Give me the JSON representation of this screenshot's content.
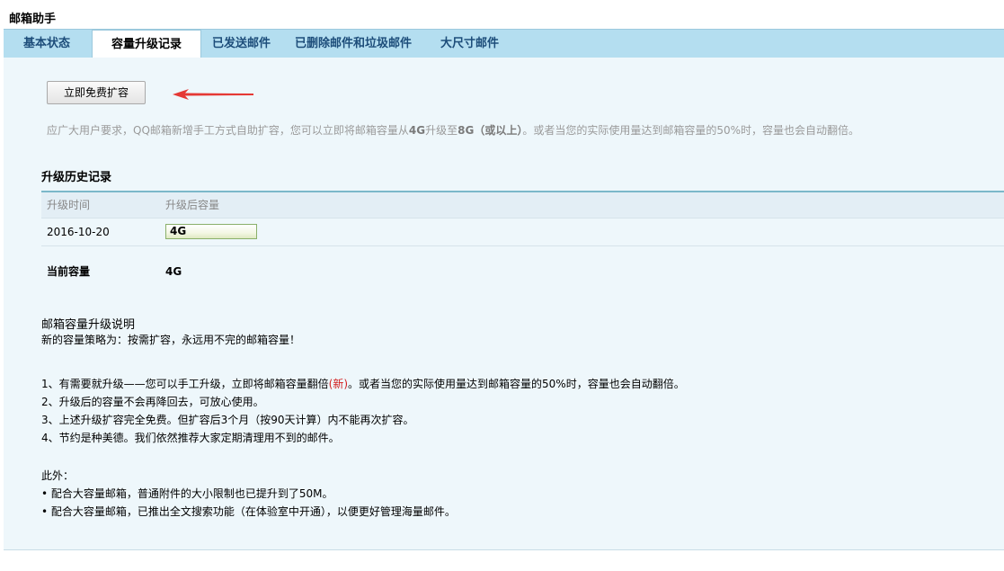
{
  "app": {
    "title": "邮箱助手"
  },
  "tabs": [
    {
      "label": "基本状态"
    },
    {
      "label": "容量升级记录"
    },
    {
      "label": "已发送邮件"
    },
    {
      "label": "已删除邮件和垃圾邮件"
    },
    {
      "label": "大尺寸邮件"
    }
  ],
  "active_tab": "容量升级记录",
  "expand_button": {
    "label": "立即免费扩容"
  },
  "intro": {
    "part1": "应广大用户要求，QQ邮箱新增手工方式自助扩容，您可以立即将邮箱容量从",
    "from": "4G",
    "part2": "升级至",
    "to": "8G（或以上）",
    "part3": "。或者当您的实际使用量达到邮箱容量的50%时，容量也会自动翻倍。"
  },
  "history": {
    "title": "升级历史记录",
    "col_time": "升级时间",
    "col_capacity": "升级后容量",
    "rows": [
      {
        "time": "2016-10-20",
        "capacity": "4G"
      }
    ],
    "current_label": "当前容量",
    "current_value": "4G"
  },
  "explain": {
    "title": "邮箱容量升级说明",
    "subtitle": "新的容量策略为：按需扩容，永远用不完的邮箱容量！",
    "item1_a": "1、有需要就升级——您可以手工升级，立即将邮箱容量翻倍",
    "item1_new": "(新)",
    "item1_b": "。或者当您的实际使用量达到邮箱容量的50%时，容量也会自动翻倍。",
    "item2": "2、升级后的容量不会再降回去，可放心使用。",
    "item3": "3、上述升级扩容完全免费。但扩容后3个月（按90天计算）内不能再次扩容。",
    "item4": "4、节约是种美德。我们依然推荐大家定期清理用不到的邮件。",
    "extra_title": "此外：",
    "extra1": "• 配合大容量邮箱，普通附件的大小限制也已提升到了50M。",
    "extra2": "• 配合大容量邮箱，已推出全文搜索功能（在体验室中开通），以便更好管理海量邮件。"
  },
  "colors": {
    "tabbar": "#b4def0",
    "content_bg": "#eef7fb",
    "table_border": "#7bb8c9",
    "arrow": "#e53935"
  }
}
